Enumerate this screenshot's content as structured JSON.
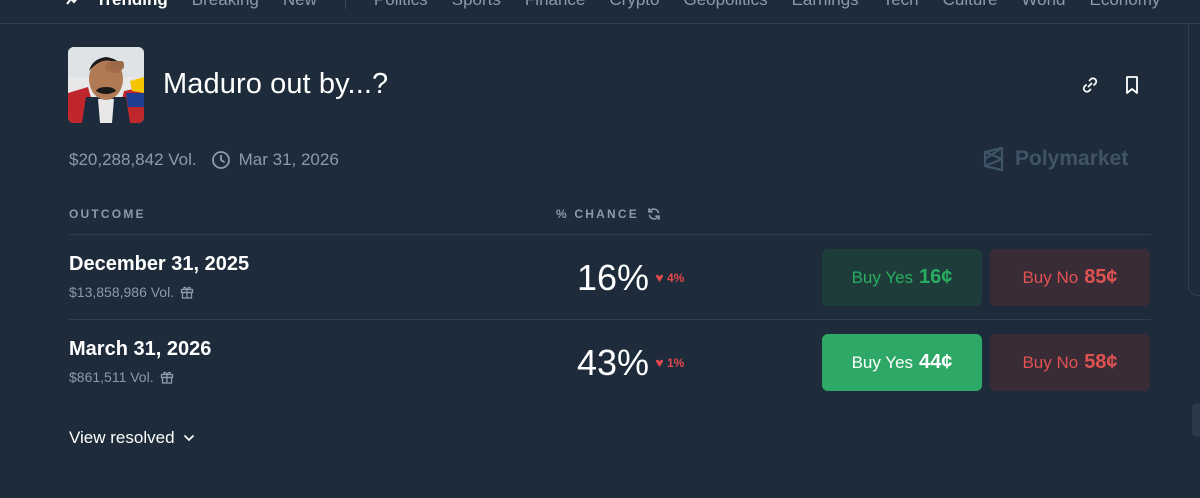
{
  "nav": {
    "items": [
      "Trending",
      "Breaking",
      "New",
      "Politics",
      "Sports",
      "Finance",
      "Crypto",
      "Geopolitics",
      "Earnings",
      "Tech",
      "Culture",
      "World",
      "Economy"
    ],
    "active": "Trending"
  },
  "market": {
    "title": "Maduro out by...?",
    "volume": "$20,288,842 Vol.",
    "end_date": "Mar 31, 2026",
    "brand": "Polymarket"
  },
  "table": {
    "outcome_header": "OUTCOME",
    "chance_header": "% CHANCE"
  },
  "outcomes": [
    {
      "name": "December 31, 2025",
      "volume": "$13,858,986 Vol.",
      "chance": "16%",
      "change": "4%",
      "buy_yes_label": "Buy Yes",
      "buy_yes_price": "16¢",
      "buy_no_label": "Buy No",
      "buy_no_price": "85¢"
    },
    {
      "name": "March 31, 2026",
      "volume": "$861,511 Vol.",
      "chance": "43%",
      "change": "1%",
      "buy_yes_label": "Buy Yes",
      "buy_yes_price": "44¢",
      "buy_no_label": "Buy No",
      "buy_no_price": "58¢"
    }
  ],
  "view_resolved_label": "View resolved",
  "colors": {
    "background": "#1d2b3a",
    "yes_green": "#2ea866",
    "no_red": "#e05252",
    "change_red": "#e5484d"
  }
}
